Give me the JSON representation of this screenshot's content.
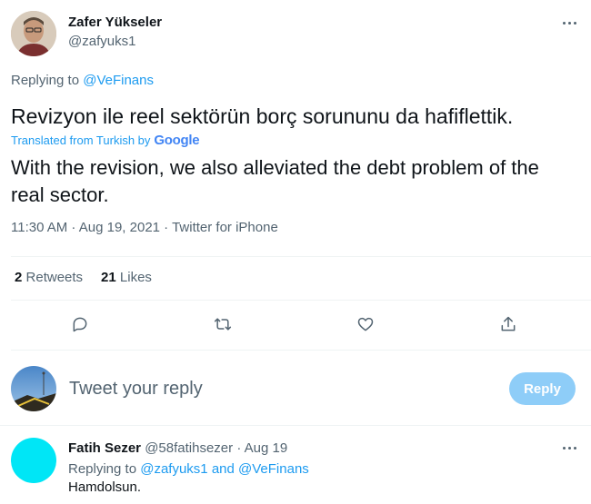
{
  "tweet": {
    "author_name": "Zafer Yükseler",
    "author_handle": "@zafyuks1",
    "replying_prefix": "Replying to",
    "replying_to": "@VeFinans",
    "text": "Revizyon ile reel sektörün borç sorununu da hafiflettik.",
    "translated_label": "Translated from Turkish by",
    "translator_brand": "Google",
    "translation": "With the revision, we also alleviated the debt problem of the real sector.",
    "meta": "11:30 AM · Aug 19, 2021 · Twitter for iPhone",
    "retweets_count": "2",
    "retweets_label": "Retweets",
    "likes_count": "21",
    "likes_label": "Likes"
  },
  "reply_box": {
    "placeholder": "Tweet your reply",
    "button_label": "Reply"
  },
  "reply": {
    "author_name": "Fatih Sezer",
    "author_handle": "@58fatihsezer",
    "date": "· Aug 19",
    "replying_prefix": "Replying to",
    "replying_to_1": "@zafyuks1",
    "and_word": "and",
    "replying_to_2": "@VeFinans",
    "text": "Hamdolsun."
  },
  "colors": {
    "accent": "#1d9bf0",
    "reply_button_disabled": "#8ecdf8",
    "reply_avatar": "#00e6f6"
  },
  "icons": [
    "more-icon",
    "reply-icon",
    "retweet-icon",
    "like-icon",
    "share-icon"
  ]
}
